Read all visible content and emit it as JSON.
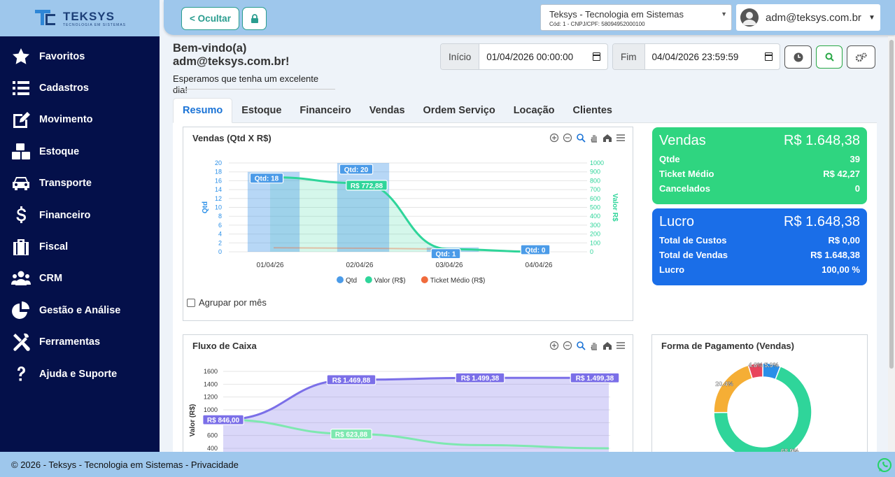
{
  "app": {
    "logo_name": "TEKSYS",
    "logo_sub": "TECNOLOGIA EM SISTEMAS",
    "hide_label": "< Ocultar",
    "company": {
      "name": "Teksys - Tecnologia em Sistemas",
      "sub": "Cód: 1 - CNPJ/CPF: 58094952000100"
    },
    "user": "adm@teksys.com.br"
  },
  "sidebar": {
    "items": [
      {
        "label": "Favoritos",
        "icon": "star-icon"
      },
      {
        "label": "Cadastros",
        "icon": "list-icon"
      },
      {
        "label": "Movimento",
        "icon": "edit-icon"
      },
      {
        "label": "Estoque",
        "icon": "boxes-icon"
      },
      {
        "label": "Transporte",
        "icon": "car-icon"
      },
      {
        "label": "Financeiro",
        "icon": "dollar-icon"
      },
      {
        "label": "Fiscal",
        "icon": "briefcase-icon"
      },
      {
        "label": "CRM",
        "icon": "users-icon"
      },
      {
        "label": "Gestão e Análise",
        "icon": "pie-chart-icon"
      },
      {
        "label": "Ferramentas",
        "icon": "tools-icon"
      },
      {
        "label": "Ajuda e Suporte",
        "icon": "question-icon"
      }
    ]
  },
  "welcome": {
    "title": "Bem-vindo(a) adm@teksys.com.br!",
    "subtitle": "Esperamos que tenha um excelente dia!"
  },
  "filters": {
    "start_label": "Início",
    "start_value": "01/04/2026 00:00:00",
    "end_label": "Fim",
    "end_value": "04/04/2026 23:59:59"
  },
  "tabs": [
    "Resumo",
    "Estoque",
    "Financeiro",
    "Vendas",
    "Ordem Serviço",
    "Locação",
    "Clientes"
  ],
  "vendas_panel": {
    "title": "Vendas (Qtd X R$)",
    "group_label": "Agrupar por mês"
  },
  "fluxo_panel": {
    "title": "Fluxo de Caixa"
  },
  "pagamento_panel": {
    "title": "Forma de Pagamento (Vendas)"
  },
  "card_vendas": {
    "title": "Vendas",
    "total": "R$ 1.648,38",
    "rows": [
      {
        "label": "Qtde",
        "value": "39"
      },
      {
        "label": "Ticket Médio",
        "value": "R$ 42,27"
      },
      {
        "label": "Cancelados",
        "value": "0"
      }
    ],
    "color": "#2fd580"
  },
  "card_lucro": {
    "title": "Lucro",
    "total": "R$ 1.648,38",
    "rows": [
      {
        "label": "Total de Custos",
        "value": "R$ 0,00"
      },
      {
        "label": "Total de Vendas",
        "value": "R$ 1.648,38"
      },
      {
        "label": "Lucro",
        "value": "100,00 %"
      }
    ],
    "color": "#1a6ee8"
  },
  "footer": {
    "text": "© 2026 - Teksys - Tecnologia em Sistemas - Privacidade"
  },
  "chart_data": [
    {
      "type": "bar",
      "title": "Vendas (Qtd X R$)",
      "categories": [
        "01/04/26",
        "02/04/26",
        "03/04/26",
        "04/04/26"
      ],
      "ylabel": "Qtd",
      "y2label": "Valor R$",
      "ylim": [
        0,
        20
      ],
      "y2lim": [
        0,
        1000
      ],
      "yticks": [
        "0",
        "2",
        "4",
        "6",
        "8",
        "10",
        "12",
        "14",
        "16",
        "18",
        "20"
      ],
      "y2ticks": [
        "0",
        "100",
        "200",
        "300",
        "400",
        "500",
        "600",
        "700",
        "800",
        "900",
        "1000"
      ],
      "series": [
        {
          "name": "Qtd",
          "type": "bar",
          "values": [
            18,
            20,
            1,
            0
          ],
          "labels": [
            "Qtd: 18",
            "Qtd: 20",
            "Qtd: 1",
            "Qtd: 0"
          ],
          "color": "#4b9be8"
        },
        {
          "name": "Valor (R$)",
          "type": "area",
          "values": [
            840,
            772.88,
            30,
            0
          ],
          "labels": [
            "",
            "R$ 772,88",
            "",
            ""
          ],
          "color": "#2fd59a"
        },
        {
          "name": "Ticket Médio (R$)",
          "type": "line",
          "values": [
            45,
            40,
            30,
            0
          ],
          "color": "#f06b3c"
        }
      ],
      "legend": "bottom"
    },
    {
      "type": "area",
      "title": "Fluxo de Caixa",
      "ylabel": "Valor (R$)",
      "ylim": [
        400,
        1600
      ],
      "yticks": [
        "1600",
        "1400",
        "1200",
        "1000",
        "800",
        "600",
        "400"
      ],
      "series": [
        {
          "name": "",
          "values": [
            846.0,
            1469.88,
            1499.38,
            1499.38
          ],
          "labels": [
            "R$ 846,00",
            "R$ 1.469,88",
            "R$ 1.499,38",
            "R$ 1.499,38"
          ],
          "color": "#7b6fe8"
        },
        {
          "name": "",
          "values": [
            846.0,
            623.88,
            450,
            400
          ],
          "labels": [
            "",
            "R$ 623,88",
            "",
            ""
          ],
          "color": "#7ee8b0"
        }
      ]
    },
    {
      "type": "pie",
      "title": "Forma de Pagamento (Vendas)",
      "slices": [
        {
          "label": "68.9%",
          "value": 68.9,
          "color": "#2fd59a"
        },
        {
          "label": "20.4%",
          "value": 20.4,
          "color": "#f5ae35"
        },
        {
          "label": "4.8%",
          "value": 4.8,
          "color": "#e8455c"
        },
        {
          "label": "5.9%",
          "value": 5.9,
          "color": "#2a8fe8"
        }
      ]
    }
  ]
}
